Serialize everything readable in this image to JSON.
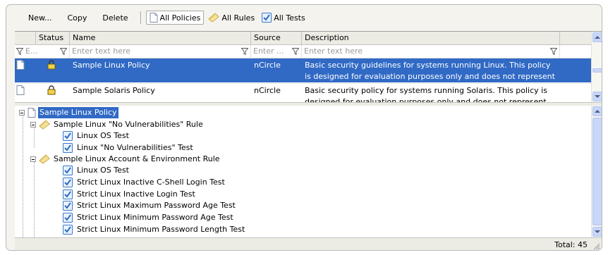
{
  "toolbar": {
    "new_label": "New...",
    "copy_label": "Copy",
    "delete_label": "Delete",
    "all_policies_label": "All Policies",
    "all_rules_label": "All Rules",
    "all_tests_label": "All Tests"
  },
  "grid": {
    "columns": [
      "Status",
      "Name",
      "Source",
      "Description"
    ],
    "filters": {
      "status_value": "E...",
      "name_placeholder": "Enter text here",
      "source_placeholder": "Enter ...",
      "description_placeholder": "Enter text here"
    },
    "rows": [
      {
        "name": "Sample Linux Policy",
        "source": "nCircle",
        "description": "Basic security guidelines for systems running Linux. This policy is designed for evaluation purposes only and does not represent reco...",
        "selected": true
      },
      {
        "name": "Sample Solaris Policy",
        "source": "nCircle",
        "description": "Basic security policy for systems running Solaris. This policy is designed for evaluation purposes only and does not represent reco...",
        "selected": false
      }
    ]
  },
  "tree": {
    "root": "Sample Linux Policy",
    "rule1": "Sample Linux \"No Vulnerabilities\" Rule",
    "rule1_tests": [
      "Linux OS Test",
      "Linux \"No Vulnerabilities\" Test"
    ],
    "rule2": "Sample Linux Account & Environment Rule",
    "rule2_tests": [
      "Linux OS Test",
      "Strict Linux Inactive C-Shell Login Test",
      "Strict Linux Inactive Login Test",
      "Strict Linux Maximum Password Age Test",
      "Strict Linux Minimum Password Age Test",
      "Strict Linux Minimum Password Length Test"
    ]
  },
  "status": {
    "total_label": "Total: 45"
  },
  "icons": {
    "document": "document-icon",
    "lock": "lock-icon",
    "rule": "rule-icon",
    "test": "test-icon",
    "funnel": "filter-icon"
  },
  "colors": {
    "selection": "#316ac5",
    "scroll": "#c8d6f8",
    "panel": "#ecebe4"
  }
}
